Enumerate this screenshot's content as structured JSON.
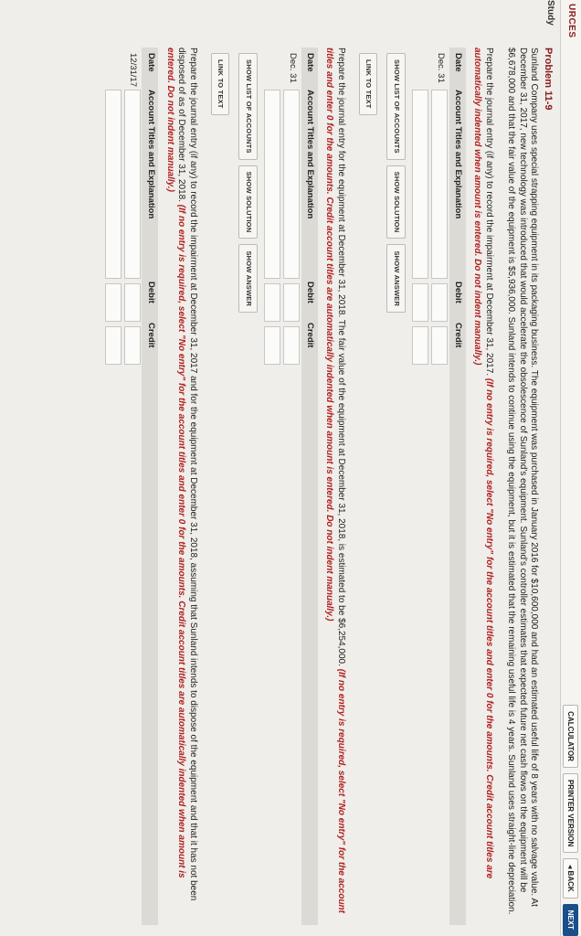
{
  "sidebar": {
    "resources_label": "URCES",
    "study_label": "Study"
  },
  "toolbar": {
    "calculator": "CALCULATOR",
    "printer": "PRINTER VERSION",
    "back": "◂ BACK",
    "next": "NEXT"
  },
  "problem": {
    "title": "Problem 11-9",
    "description": "Sunland Company uses special strapping equipment in its packaging business. The equipment was purchased in January 2016 for $10,600,000 and had an estimated useful life of 8 years with no salvage value. At December 31, 2017, new technology was introduced that would accelerate the obsolescence of Sunland's equipment. Sunland's controller estimates that expected future net cash flows on the equipment will be $6,678,000 and that the fair value of the equipment is $5,936,000. Sunland intends to continue using the equipment, but it is estimated that the remaining useful life is 4 years. Sunland uses straight-line depreciation."
  },
  "parts": [
    {
      "instruction": "Prepare the journal entry (if any) to record the impairment at December 31, 2017.",
      "note": "(If no entry is required, select \"No entry\" for the account titles and enter 0 for the amounts. Credit account titles are automatically indented when amount is entered. Do not indent manually.)",
      "date": "Dec. 31"
    },
    {
      "instruction": "Prepare the journal entry for the equipment at December 31, 2018. The fair value of the equipment at December 31, 2018, is estimated to be $6,254,000.",
      "note": "(If no entry is required, select \"No entry\" for the account titles and enter 0 for the amounts. Credit account titles are automatically indented when amount is entered. Do not indent manually.)",
      "date": "Dec. 31"
    },
    {
      "instruction": "Prepare the journal entry (if any) to record the impairment at December 31, 2017 and for the equipment at December 31, 2018, assuming that Sunland intends to dispose of the equipment and that it has not been disposed of as of December 31, 2018.",
      "note": "(If no entry is required, select \"No entry\" for the account titles and enter 0 for the amounts. Credit account titles are automatically indented when amount is entered. Do not indent manually.)",
      "date": "12/31/17"
    }
  ],
  "table": {
    "date": "Date",
    "account": "Account Titles and Explanation",
    "debit": "Debit",
    "credit": "Credit"
  },
  "buttons": {
    "show_accounts": "SHOW LIST OF ACCOUNTS",
    "show_solution": "SHOW SOLUTION",
    "show_answer": "SHOW ANSWER",
    "link_text": "LINK TO TEXT"
  }
}
